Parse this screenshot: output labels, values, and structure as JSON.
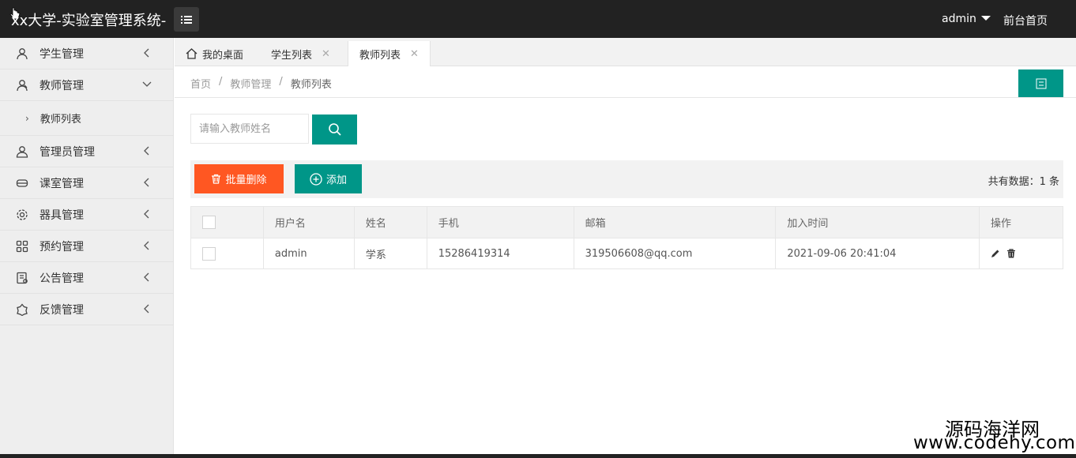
{
  "header": {
    "title": "xx大学-实验室管理系统-",
    "user": "admin",
    "front_link": "前台首页"
  },
  "sidebar": {
    "items": [
      {
        "label": "学生管理",
        "icon": "user-icon"
      },
      {
        "label": "教师管理",
        "icon": "teacher-icon",
        "expanded": true,
        "children": [
          {
            "label": "教师列表"
          }
        ]
      },
      {
        "label": "管理员管理",
        "icon": "admin-icon"
      },
      {
        "label": "课室管理",
        "icon": "classroom-icon"
      },
      {
        "label": "器具管理",
        "icon": "gear-icon"
      },
      {
        "label": "预约管理",
        "icon": "grid-icon"
      },
      {
        "label": "公告管理",
        "icon": "notice-icon"
      },
      {
        "label": "反馈管理",
        "icon": "feedback-icon"
      }
    ]
  },
  "tabs": [
    {
      "label": "我的桌面"
    },
    {
      "label": "学生列表"
    },
    {
      "label": "教师列表",
      "active": true
    }
  ],
  "breadcrumb": [
    "首页",
    "教师管理",
    "教师列表"
  ],
  "search": {
    "placeholder": "请输入教师姓名",
    "value": ""
  },
  "toolbar": {
    "delete_label": "批量删除",
    "add_label": "添加",
    "total": "共有数据：1 条"
  },
  "table": {
    "headers": [
      "用户名",
      "姓名",
      "手机",
      "邮箱",
      "加入时间",
      "操作"
    ],
    "rows": [
      {
        "username": "admin",
        "name": "学系",
        "phone": "15286419314",
        "email": "319506608@qq.com",
        "joined": "2021-09-06 20:41:04"
      }
    ]
  },
  "watermark": {
    "line1": "源码海洋网",
    "line2": "www.codehy.com"
  },
  "colors": {
    "accent": "#009688",
    "danger": "#FF5722",
    "topbar": "#222222",
    "sidebar": "#eeeeee"
  }
}
